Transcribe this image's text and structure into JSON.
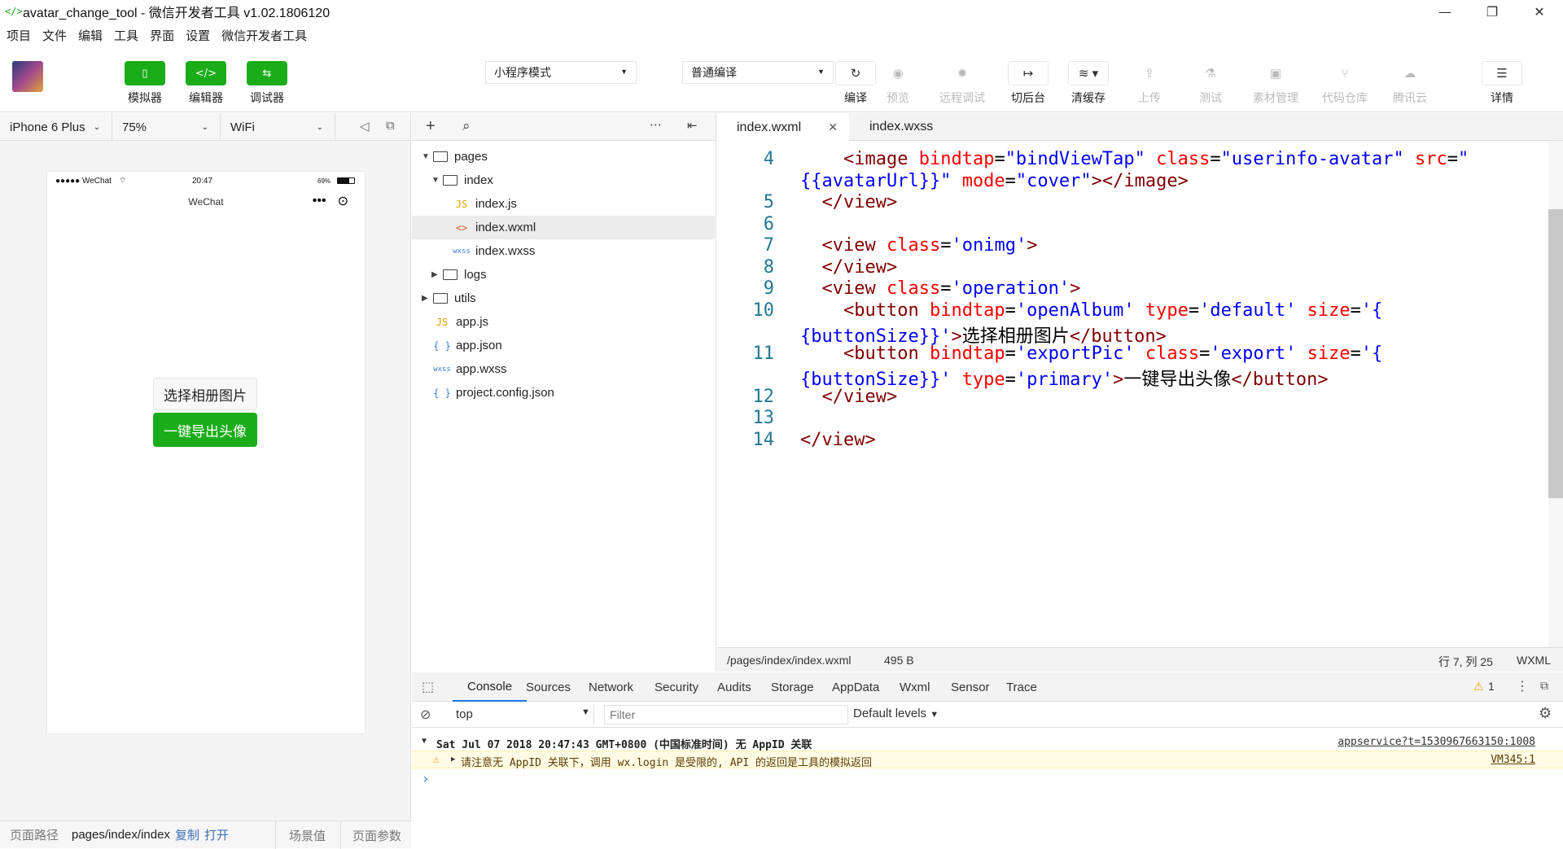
{
  "window": {
    "title": "avatar_change_tool - 微信开发者工具 v1.02.1806120",
    "min": "—",
    "restore": "❐",
    "close": "✕"
  },
  "menu": [
    "项目",
    "文件",
    "编辑",
    "工具",
    "界面",
    "设置",
    "微信开发者工具"
  ],
  "toolbar": {
    "simulator": "模拟器",
    "editor": "编辑器",
    "debugger": "调试器",
    "mode": "小程序模式",
    "compile_mode": "普通编译",
    "compile": "编译",
    "preview": "预览",
    "remote_debug": "远程调试",
    "background": "切后台",
    "clear_cache": "清缓存",
    "upload": "上传",
    "test": "测试",
    "assets": "素材管理",
    "code_repo": "代码仓库",
    "tencent_cloud": "腾讯云",
    "details": "详情"
  },
  "device": {
    "model": "iPhone 6 Plus",
    "zoom": "75%",
    "network": "WiFi"
  },
  "phone": {
    "carrier": "●●●●● WeChat",
    "time": "20:47",
    "battery": "69%",
    "nav_title": "WeChat",
    "btn_album": "选择相册图片",
    "btn_export": "一键导出头像"
  },
  "pathbar": {
    "label": "页面路径",
    "path": "pages/index/index",
    "copy": "复制",
    "open": "打开",
    "scene": "场景值",
    "params": "页面参数"
  },
  "files": [
    {
      "name": "pages",
      "type": "folder",
      "depth": 0,
      "open": true
    },
    {
      "name": "index",
      "type": "folder",
      "depth": 1,
      "open": true
    },
    {
      "name": "index.js",
      "type": "js",
      "depth": 2
    },
    {
      "name": "index.wxml",
      "type": "wxml",
      "depth": 2,
      "selected": true
    },
    {
      "name": "index.wxss",
      "type": "wxss",
      "depth": 2
    },
    {
      "name": "logs",
      "type": "folder",
      "depth": 1,
      "open": false
    },
    {
      "name": "utils",
      "type": "folder",
      "depth": 0,
      "open": false
    },
    {
      "name": "app.js",
      "type": "js",
      "depth": 0
    },
    {
      "name": "app.json",
      "type": "json",
      "depth": 0
    },
    {
      "name": "app.wxss",
      "type": "wxss",
      "depth": 0
    },
    {
      "name": "project.config.json",
      "type": "json",
      "depth": 0
    }
  ],
  "tabs": [
    {
      "name": "index.wxml",
      "active": true
    },
    {
      "name": "index.wxss",
      "active": false
    }
  ],
  "code_lines": [
    {
      "n": "4",
      "html": "    <span class='tg'>&lt;image</span> <span class='at'>bindtap</span>=<span class='sv'>\"bindViewTap\"</span> <span class='at'>class</span>=<span class='sv'>\"userinfo-avatar\"</span> <span class='at'>src</span>=<span class='sv'>\"</span>"
    },
    {
      "n": "",
      "html": "<span class='sv'>{{avatarUrl}}\"</span> <span class='at'>mode</span>=<span class='sv'>\"cover\"</span><span class='tg'>&gt;&lt;/image&gt;</span>"
    },
    {
      "n": "5",
      "html": "  <span class='tg'>&lt;/view&gt;</span>"
    },
    {
      "n": "6",
      "html": ""
    },
    {
      "n": "7",
      "html": "  <span class='tg'>&lt;view</span> <span class='at'>class</span>=<span class='sv'>'onimg'</span><span class='tg'>&gt;</span>"
    },
    {
      "n": "8",
      "html": "  <span class='tg'>&lt;/view&gt;</span>"
    },
    {
      "n": "9",
      "html": "  <span class='tg'>&lt;view</span> <span class='at'>class</span>=<span class='sv'>'operation'</span><span class='tg'>&gt;</span>"
    },
    {
      "n": "10",
      "html": "    <span class='tg'>&lt;button</span> <span class='at'>bindtap</span>=<span class='sv'>'openAlbum'</span> <span class='at'>type</span>=<span class='sv'>'default'</span> <span class='at'>size</span>=<span class='sv'>'{</span>"
    },
    {
      "n": "",
      "html": "<span class='sv'>{buttonSize}}'</span><span class='tg'>&gt;</span>选择相册图片<span class='tg'>&lt;/button&gt;</span>"
    },
    {
      "n": "11",
      "html": "    <span class='tg'>&lt;button</span> <span class='at'>bindtap</span>=<span class='sv'>'exportPic'</span> <span class='at'>class</span>=<span class='sv'>'export'</span> <span class='at'>size</span>=<span class='sv'>'{</span>"
    },
    {
      "n": "",
      "html": "<span class='sv'>{buttonSize}}'</span> <span class='at'>type</span>=<span class='sv'>'primary'</span><span class='tg'>&gt;</span>一键导出头像<span class='tg'>&lt;/button&gt;</span>"
    },
    {
      "n": "12",
      "html": "  <span class='tg'>&lt;/view&gt;</span>"
    },
    {
      "n": "13",
      "html": ""
    },
    {
      "n": "14",
      "html": "<span class='tg'>&lt;/view&gt;</span>"
    }
  ],
  "editor_status": {
    "path": "/pages/index/index.wxml",
    "size": "495 B",
    "cursor": "行 7, 列 25",
    "lang": "WXML"
  },
  "devtools": {
    "tabs": [
      "Console",
      "Sources",
      "Network",
      "Security",
      "Audits",
      "Storage",
      "AppData",
      "Wxml",
      "Sensor",
      "Trace"
    ],
    "warn_count": "1",
    "context": "top",
    "filter_placeholder": "Filter",
    "levels": "Default levels",
    "log_header": "Sat Jul 07 2018 20:47:43 GMT+0800 (中国标准时间) 无 AppID 关联",
    "log_header_src": "appservice?t=1530967663150:1008",
    "log_warn": "请注意无 AppID 关联下，调用 wx.login 是受限的, API 的返回是工具的模拟返回",
    "log_warn_src": "VM345:1",
    "prompt": "›"
  }
}
